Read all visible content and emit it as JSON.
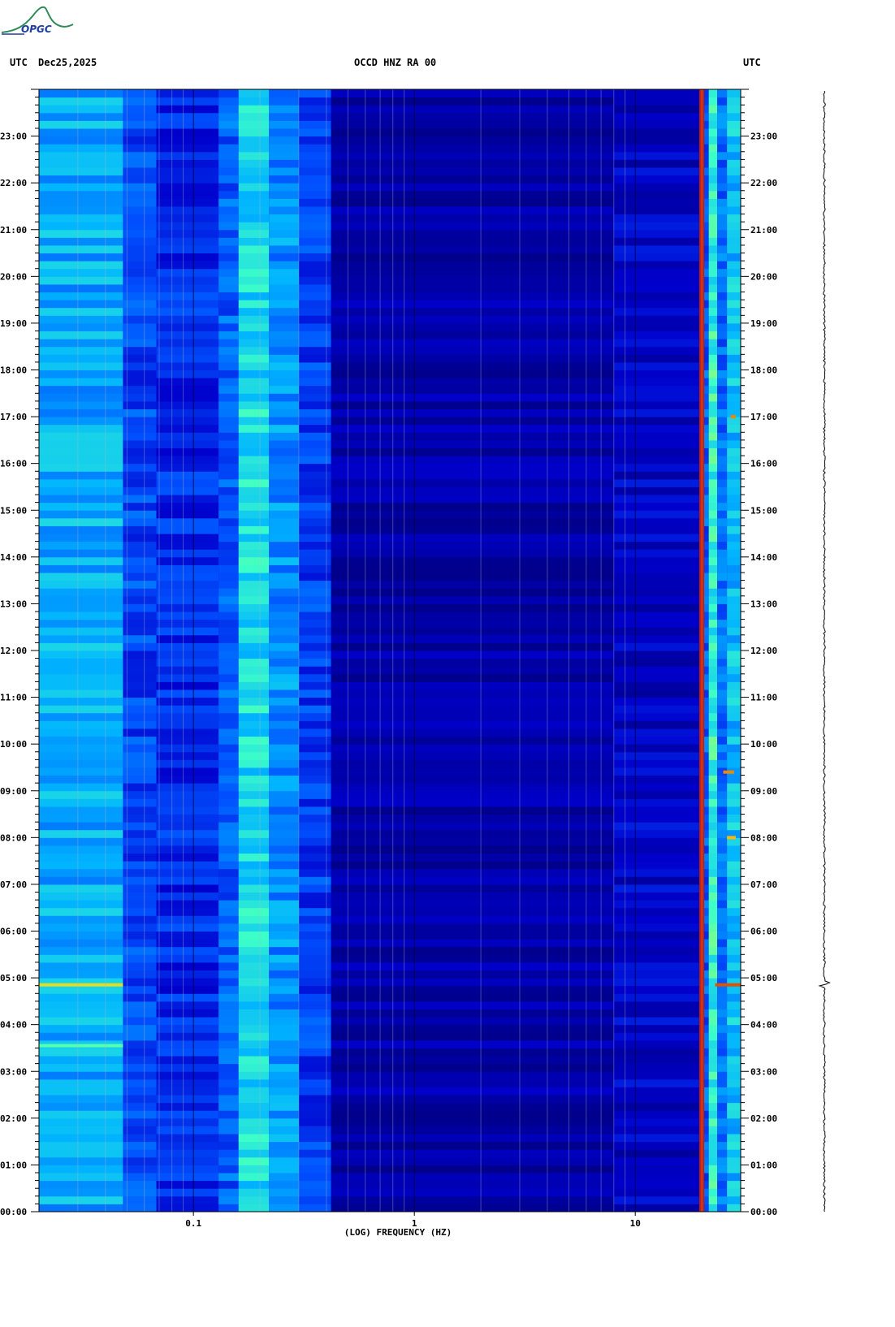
{
  "header": {
    "left_tz": "UTC",
    "date": "Dec25,2025",
    "station": "OCCD HNZ RA 00",
    "right_tz": "UTC"
  },
  "logo": {
    "text": "OPGC"
  },
  "chart_data": {
    "type": "heatmap",
    "title": "OCCD HNZ RA 00",
    "xlabel": "(LOG) FREQUENCY (HZ)",
    "xscale": "log",
    "xlim": [
      0.02,
      30
    ],
    "xticks": [
      {
        "value": 0.1,
        "label": "0.1"
      },
      {
        "value": 1,
        "label": "1"
      },
      {
        "value": 10,
        "label": "10"
      }
    ],
    "ylim": [
      0,
      24
    ],
    "yticks": [
      "00:00",
      "01:00",
      "02:00",
      "03:00",
      "04:00",
      "05:00",
      "06:00",
      "07:00",
      "08:00",
      "09:00",
      "10:00",
      "11:00",
      "12:00",
      "13:00",
      "14:00",
      "15:00",
      "16:00",
      "17:00",
      "18:00",
      "19:00",
      "20:00",
      "21:00",
      "22:00",
      "23:00"
    ],
    "colormap": [
      "#00008c",
      "#0000cc",
      "#0050ff",
      "#00b4ff",
      "#3cffc8",
      "#c8ff3c",
      "#ffb400",
      "#cc1e00"
    ],
    "grid": true,
    "bands": [
      {
        "f1": 0.02,
        "f2": 0.048,
        "level": 0.42
      },
      {
        "f1": 0.048,
        "f2": 0.068,
        "level": 0.26
      },
      {
        "f1": 0.068,
        "f2": 0.13,
        "level": 0.22
      },
      {
        "f1": 0.13,
        "f2": 0.16,
        "level": 0.3
      },
      {
        "f1": 0.16,
        "f2": 0.22,
        "level": 0.5
      },
      {
        "f1": 0.22,
        "f2": 0.3,
        "level": 0.38
      },
      {
        "f1": 0.3,
        "f2": 0.42,
        "level": 0.25
      },
      {
        "f1": 0.42,
        "f2": 8.0,
        "level": 0.06
      },
      {
        "f1": 8.0,
        "f2": 19.5,
        "level": 0.12
      },
      {
        "f1": 19.5,
        "f2": 20.5,
        "level": 1.0
      },
      {
        "f1": 20.5,
        "f2": 21.5,
        "level": 0.3
      },
      {
        "f1": 21.5,
        "f2": 23.5,
        "level": 0.55
      },
      {
        "f1": 23.5,
        "f2": 26.0,
        "level": 0.32
      },
      {
        "f1": 26.0,
        "f2": 30.0,
        "level": 0.45
      }
    ],
    "events": [
      {
        "time": 4.85,
        "f1": 0.02,
        "f2": 0.048,
        "level": 0.78
      },
      {
        "time": 4.85,
        "f1": 23.0,
        "f2": 30.0,
        "level": 0.95
      },
      {
        "time": 3.55,
        "f1": 0.02,
        "f2": 0.048,
        "level": 0.6
      },
      {
        "time": 9.4,
        "f1": 25.0,
        "f2": 28.0,
        "level": 0.9
      },
      {
        "time": 8.0,
        "f1": 26.0,
        "f2": 28.5,
        "level": 0.85
      },
      {
        "time": 17.0,
        "f1": 27.0,
        "f2": 28.5,
        "level": 0.9
      }
    ],
    "trace": {
      "spike_time": 4.85
    }
  }
}
